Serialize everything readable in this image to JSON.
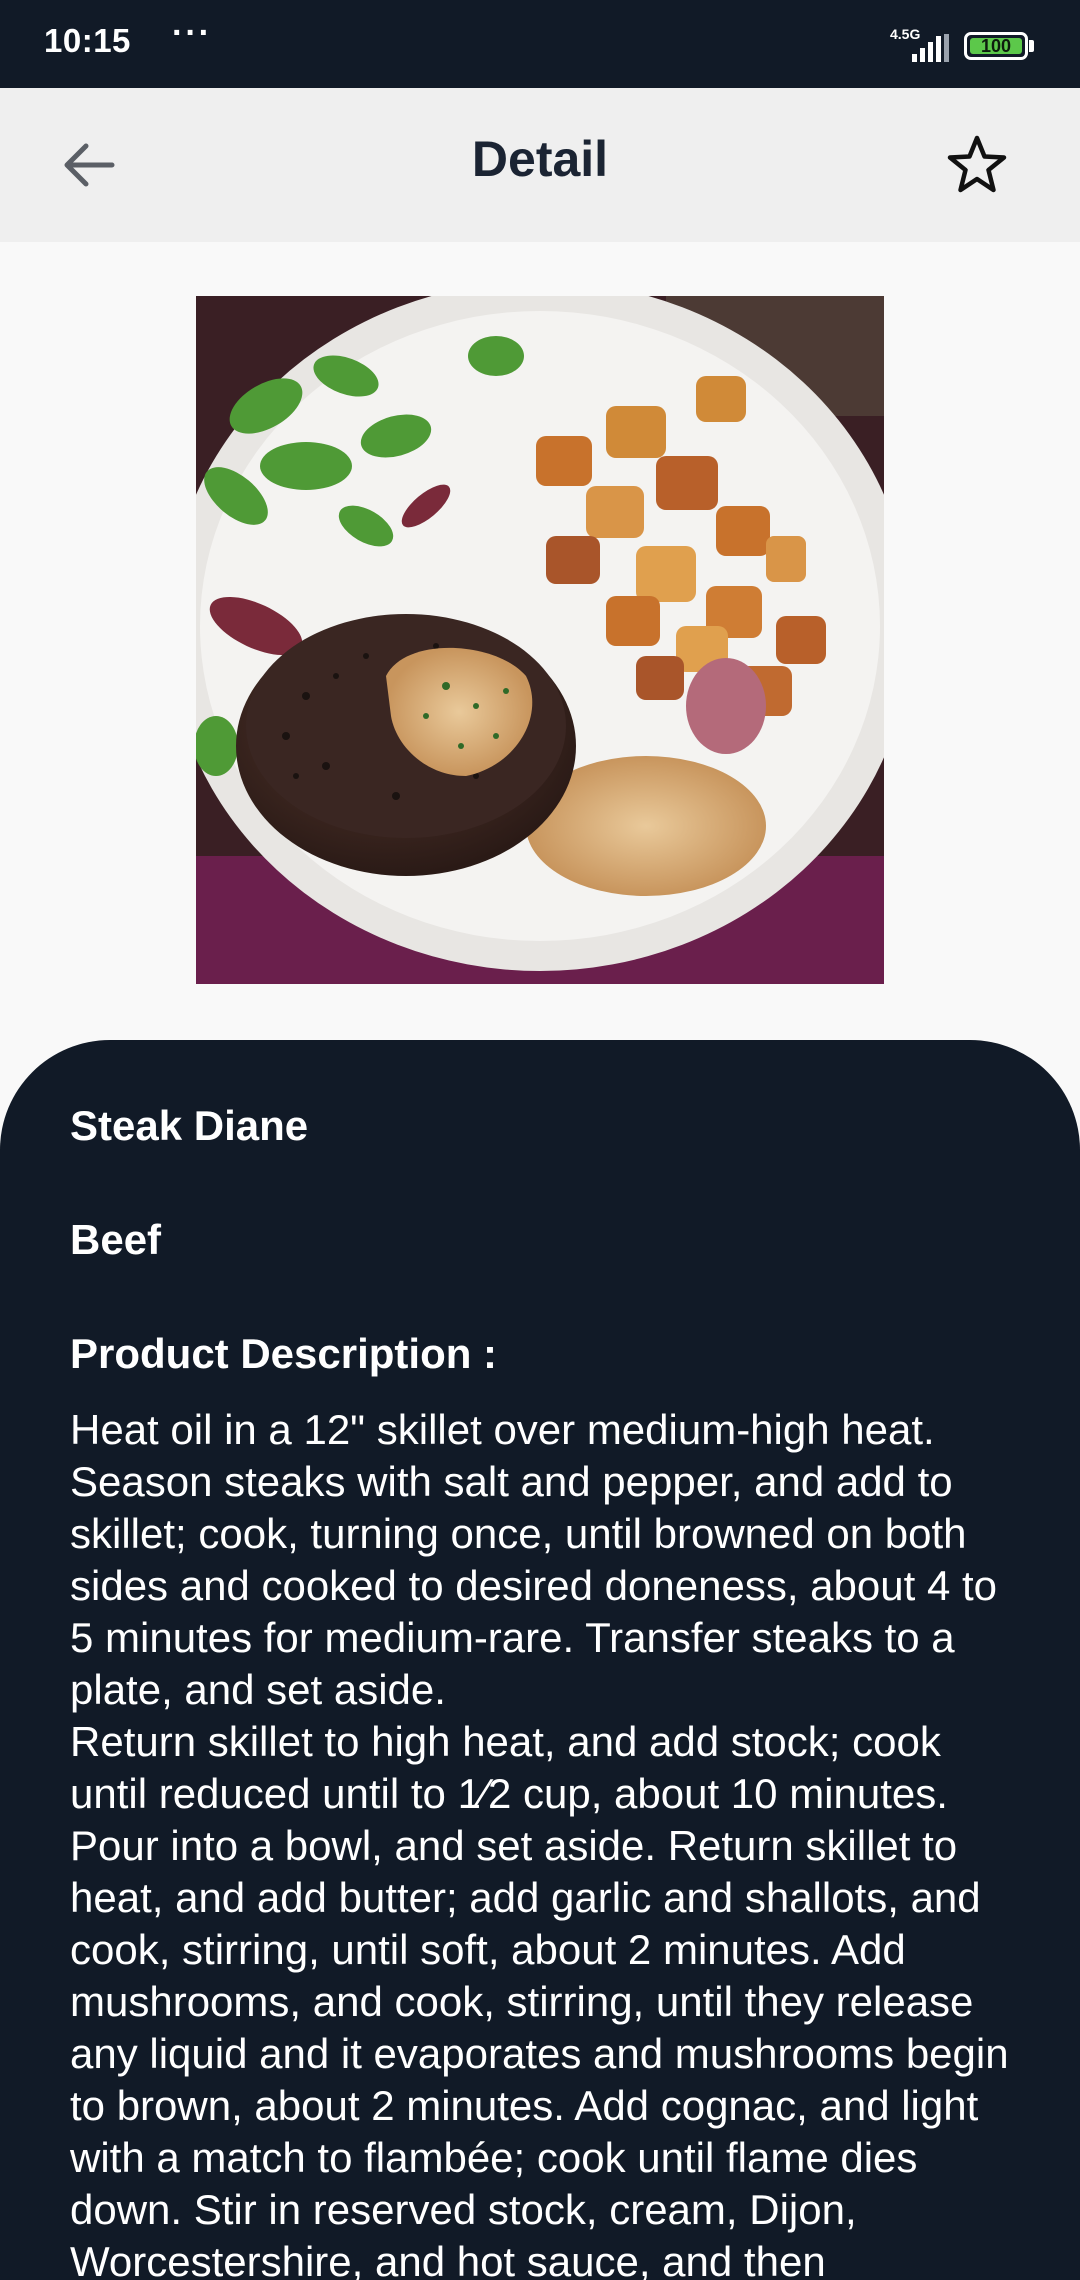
{
  "status_bar": {
    "time": "10:15",
    "dots": "···",
    "network": "4.5G",
    "battery": "100"
  },
  "app_bar": {
    "title": "Detail",
    "back_icon": "arrow-left-icon",
    "favorite_icon": "star-outline-icon"
  },
  "meal": {
    "image_alt": "Steak Diane with roasted potatoes and salad",
    "name": "Steak Diane",
    "category": "Beef",
    "description_label": "Product Description :",
    "description": "Heat oil in a 12\" skillet over medium-high heat. Season steaks with salt and pepper, and add to skillet; cook, turning once, until browned on both sides and cooked to desired doneness, about 4 to 5 minutes for medium-rare. Transfer steaks to a plate, and set aside.\nReturn skillet to high heat, and add stock; cook until reduced until to 1⁄2 cup, about 10 minutes. Pour into a bowl, and set aside. Return skillet to heat, and add butter; add garlic and shallots, and cook, stirring, until soft, about 2 minutes. Add mushrooms, and cook, stirring, until they release any liquid and it evaporates and mushrooms begin to brown, about 2 minutes. Add cognac, and light with a match to flambée; cook until flame dies down. Stir in reserved stock, cream, Dijon, Worcestershire, and hot sauce, and then"
  },
  "colors": {
    "status_bar": "#111a27",
    "app_bar": "#efefef",
    "panel": "#111a27",
    "battery": "#5cc84a"
  }
}
